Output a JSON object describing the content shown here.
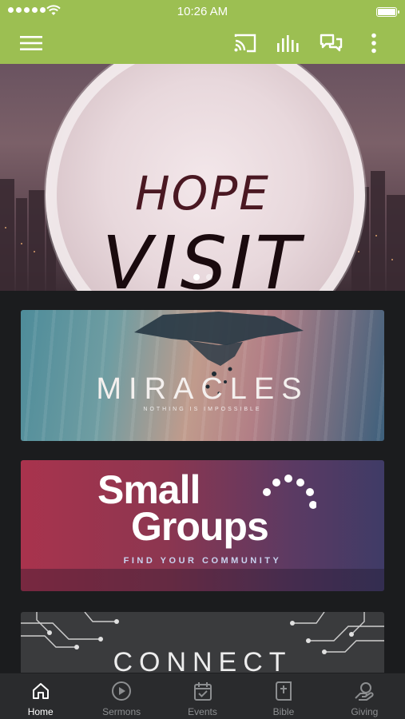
{
  "status_bar": {
    "time": "10:26 AM"
  },
  "app_bar": {
    "icons": [
      "menu-icon",
      "cast-icon",
      "audio-bars-icon",
      "chat-icon",
      "more-vert-icon"
    ],
    "accent_color": "#9cbf52"
  },
  "hero": {
    "line1": "HOPE",
    "line2": "VISIT",
    "slides": 2,
    "active_slide": 1
  },
  "cards": {
    "miracles": {
      "title": "MIRACLES",
      "subtitle": "NOTHING IS IMPOSSIBLE"
    },
    "small_groups": {
      "line1": "Small",
      "line2": "Groups",
      "subtitle": "FIND YOUR COMMUNITY"
    },
    "connect": {
      "title": "CONNECT"
    }
  },
  "tabs": [
    {
      "label": "Home",
      "icon": "home-icon",
      "active": true
    },
    {
      "label": "Sermons",
      "icon": "play-circle-icon",
      "active": false
    },
    {
      "label": "Events",
      "icon": "calendar-check-icon",
      "active": false
    },
    {
      "label": "Bible",
      "icon": "bible-icon",
      "active": false
    },
    {
      "label": "Giving",
      "icon": "giving-icon",
      "active": false
    }
  ]
}
